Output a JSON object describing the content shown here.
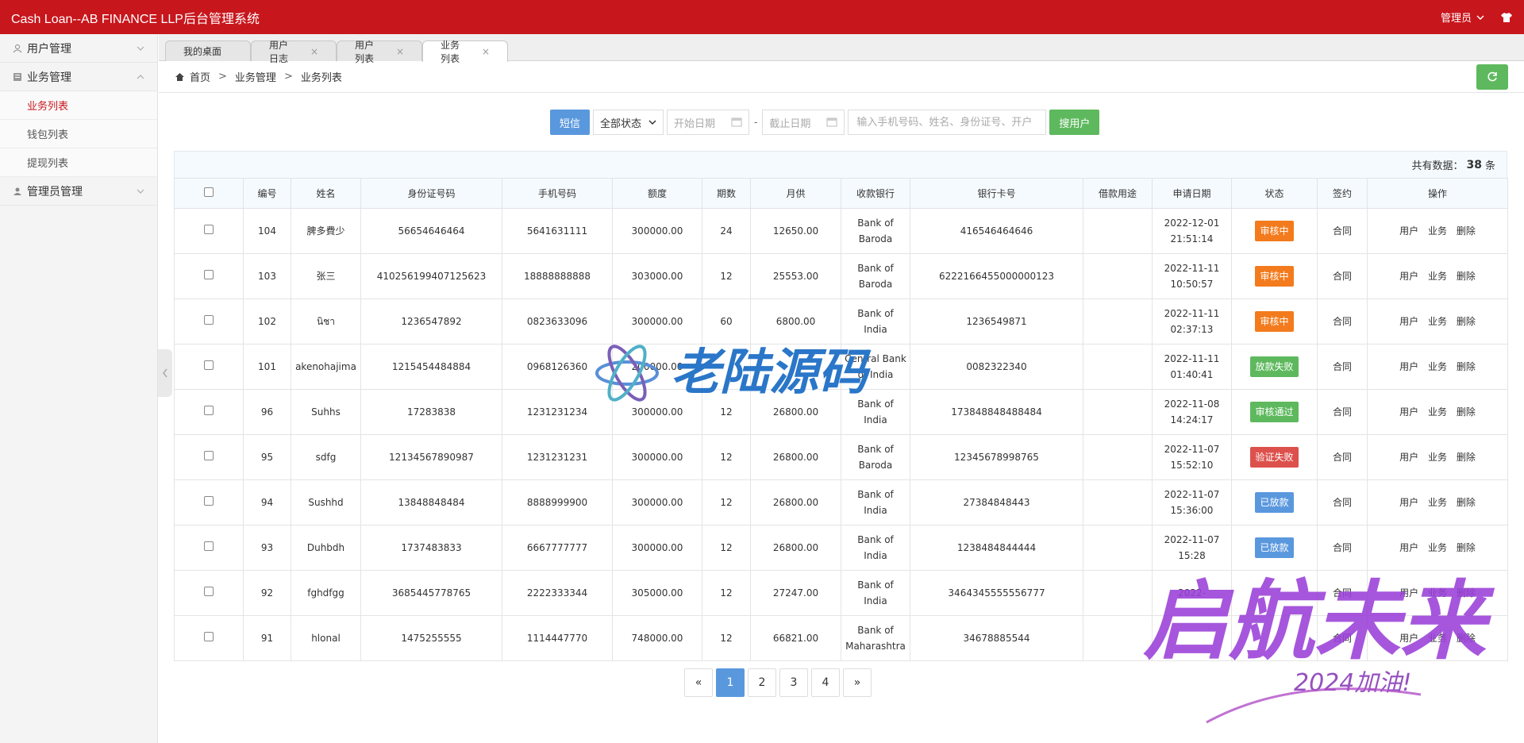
{
  "header": {
    "title": "Cash Loan--AB FINANCE LLP后台管理系统",
    "admin_label": "管理员"
  },
  "sidebar": {
    "groups": [
      {
        "label": "用户管理"
      },
      {
        "label": "业务管理",
        "subs": [
          "业务列表",
          "钱包列表",
          "提现列表"
        ]
      },
      {
        "label": "管理员管理"
      }
    ]
  },
  "tabs": [
    "我的桌面",
    "用户日志",
    "用户列表",
    "业务列表"
  ],
  "breadcrumb": [
    "首页",
    "业务管理",
    "业务列表"
  ],
  "toolbar": {
    "sms_label": "短信",
    "status_select": "全部状态",
    "start_date_placeholder": "开始日期",
    "end_date_placeholder": "截止日期",
    "search_placeholder": "输入手机号码、姓名、身份证号、开户",
    "search_button": "搜用户"
  },
  "count": {
    "prefix": "共有数据：",
    "value": "38",
    "suffix": "条"
  },
  "columns": [
    "编号",
    "姓名",
    "身份证号码",
    "手机号码",
    "额度",
    "期数",
    "月供",
    "收款银行",
    "银行卡号",
    "借款用途",
    "申请日期",
    "状态",
    "签约",
    "操作"
  ],
  "rows": [
    {
      "id": "104",
      "name": "脾多費少",
      "idcard": "56654646464",
      "phone": "5641631111",
      "amount": "300000.00",
      "term": "24",
      "monthly": "12650.00",
      "bank": "Bank of Baroda",
      "card": "416546464646",
      "purpose": "",
      "date": "2022-12-01 21:51:14",
      "status": "审核中",
      "sign": "合同"
    },
    {
      "id": "103",
      "name": "张三",
      "idcard": "410256199407125623",
      "phone": "18888888888",
      "amount": "303000.00",
      "term": "12",
      "monthly": "25553.00",
      "bank": "Bank of Baroda",
      "card": "6222166455000000123",
      "purpose": "",
      "date": "2022-11-11 10:50:57",
      "status": "审核中",
      "sign": "合同"
    },
    {
      "id": "102",
      "name": "นิชา",
      "idcard": "1236547892",
      "phone": "0823633096",
      "amount": "300000.00",
      "term": "60",
      "monthly": "6800.00",
      "bank": "Bank of India",
      "card": "1236549871",
      "purpose": "",
      "date": "2022-11-11 02:37:13",
      "status": "审核中",
      "sign": "合同"
    },
    {
      "id": "101",
      "name": "akenohajima",
      "idcard": "1215454484884",
      "phone": "0968126360",
      "amount": "200000.00",
      "term": "",
      "monthly": "",
      "bank": "Central Bank of India",
      "card": "0082322340",
      "purpose": "",
      "date": "2022-11-11 01:40:41",
      "status": "放款失败",
      "sign": "合同"
    },
    {
      "id": "96",
      "name": "Suhhs",
      "idcard": "17283838",
      "phone": "1231231234",
      "amount": "300000.00",
      "term": "12",
      "monthly": "26800.00",
      "bank": "Bank of India",
      "card": "173848848488484",
      "purpose": "",
      "date": "2022-11-08 14:24:17",
      "status": "审核通过",
      "sign": "合同"
    },
    {
      "id": "95",
      "name": "sdfg",
      "idcard": "12134567890987",
      "phone": "1231231231",
      "amount": "300000.00",
      "term": "12",
      "monthly": "26800.00",
      "bank": "Bank of Baroda",
      "card": "12345678998765",
      "purpose": "",
      "date": "2022-11-07 15:52:10",
      "status": "验证失败",
      "sign": "合同"
    },
    {
      "id": "94",
      "name": "Sushhd",
      "idcard": "13848848484",
      "phone": "8888999900",
      "amount": "300000.00",
      "term": "12",
      "monthly": "26800.00",
      "bank": "Bank of India",
      "card": "27384848443",
      "purpose": "",
      "date": "2022-11-07 15:36:00",
      "status": "已放款",
      "sign": "合同"
    },
    {
      "id": "93",
      "name": "Duhbdh",
      "idcard": "1737483833",
      "phone": "6667777777",
      "amount": "300000.00",
      "term": "12",
      "monthly": "26800.00",
      "bank": "Bank of India",
      "card": "1238484844444",
      "purpose": "",
      "date": "2022-11-07 15:28",
      "status": "已放款",
      "sign": "合同"
    },
    {
      "id": "92",
      "name": "fghdfgg",
      "idcard": "3685445778765",
      "phone": "2222333344",
      "amount": "305000.00",
      "term": "12",
      "monthly": "27247.00",
      "bank": "Bank of India",
      "card": "3464345555556777",
      "purpose": "",
      "date": "2022-",
      "status": "",
      "sign": "合同"
    },
    {
      "id": "91",
      "name": "hlonal",
      "idcard": "1475255555",
      "phone": "1114447770",
      "amount": "748000.00",
      "term": "12",
      "monthly": "66821.00",
      "bank": "Bank of Maharashtra",
      "card": "34678885544",
      "purpose": "",
      "date": "",
      "status": "",
      "sign": "合同"
    }
  ],
  "ops": [
    "用户",
    "业务",
    "删除"
  ],
  "status_colors": {
    "审核中": "#f37b1d",
    "放款失败": "#5eb95e",
    "审核通过": "#5eb95e",
    "验证失败": "#dd514c",
    "已放款": "#5a98de"
  },
  "pager": [
    "«",
    "1",
    "2",
    "3",
    "4",
    "»"
  ],
  "watermark": {
    "center_text": "老陆源码",
    "corner_text": "启航未来",
    "corner_sub": "2024加油!"
  }
}
